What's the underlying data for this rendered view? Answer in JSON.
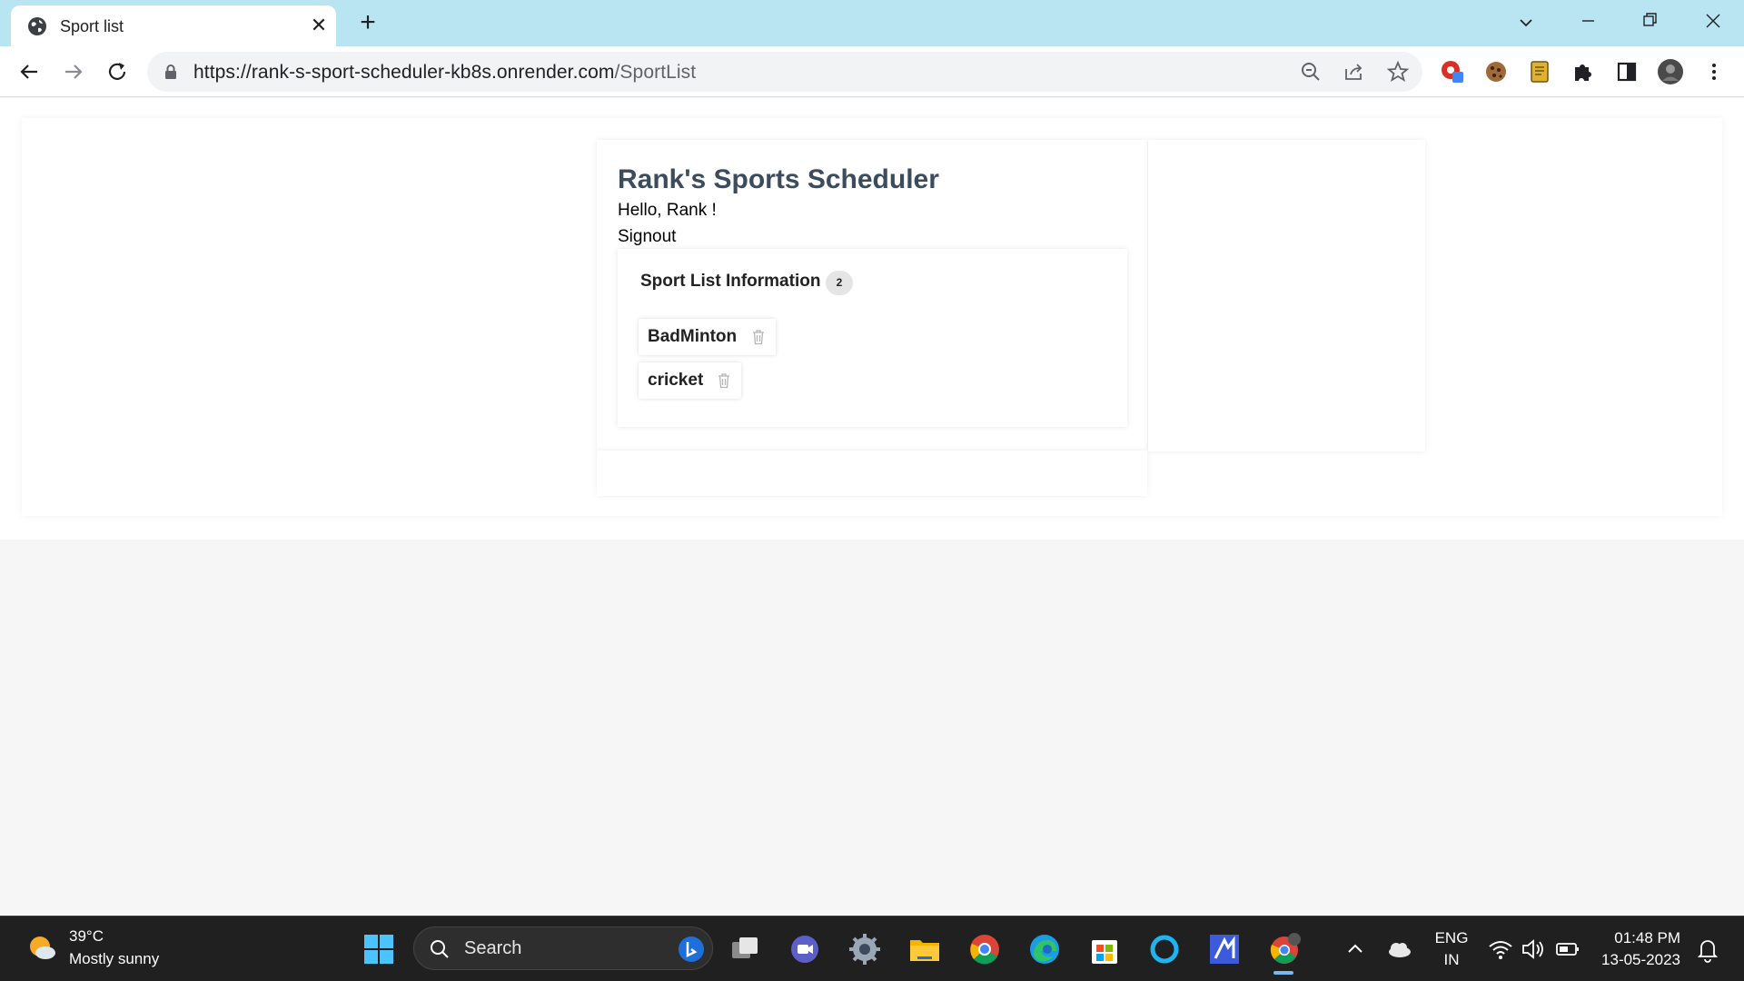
{
  "browser": {
    "tab_title": "Sport list",
    "new_tab_symbol": "+",
    "close_symbol": "✕",
    "url_host": "https://rank-s-sport-scheduler-kb8s.onrender.com",
    "url_path": "/SportList"
  },
  "app": {
    "title": "Rank's Sports Scheduler",
    "greeting": "Hello, Rank !",
    "signout": "Signout"
  },
  "sport_list": {
    "heading": "Sport List Information",
    "count": "2",
    "items": [
      {
        "name": "BadMinton"
      },
      {
        "name": "cricket"
      }
    ]
  },
  "taskbar": {
    "weather_temp": "39°C",
    "weather_desc": "Mostly sunny",
    "search_label": "Search",
    "language_line1": "ENG",
    "language_line2": "IN",
    "time": "01:48 PM",
    "date": "13-05-2023"
  },
  "icons": {
    "favicon": "globe-icon",
    "back": "arrow-left-icon",
    "forward": "arrow-right-icon",
    "reload": "reload-icon",
    "zoom": "zoom-out-icon",
    "share": "share-icon",
    "bookmark": "star-icon",
    "extensions": "puzzle-icon",
    "side_panel": "side-panel-icon",
    "menu": "kebab-menu-icon",
    "delete": "trash-icon"
  },
  "colors": {
    "tabbar_bg": "#b9e4f1",
    "title_text": "#3d4c5c",
    "taskbar_bg": "#202020"
  }
}
